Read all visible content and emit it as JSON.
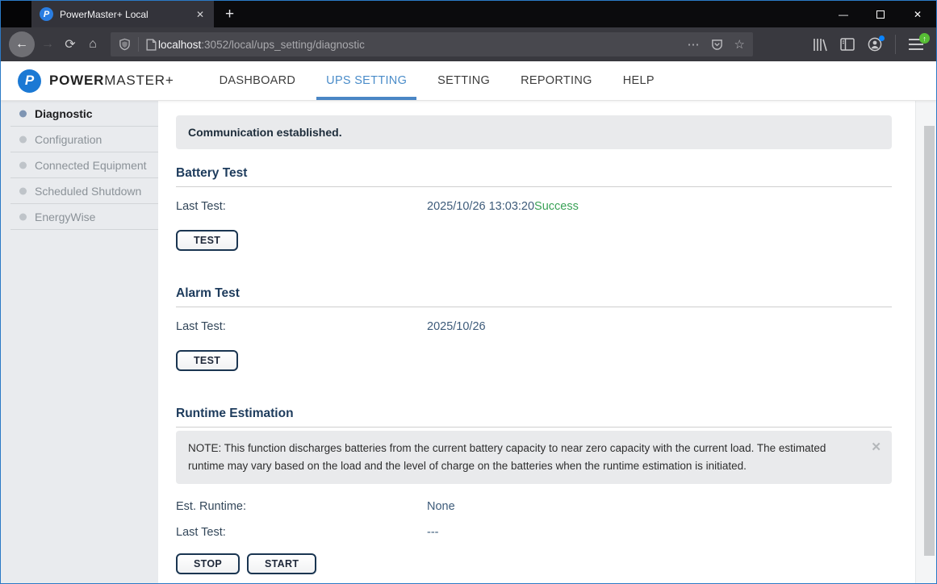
{
  "browser": {
    "tab_title": "PowerMaster+ Local",
    "favicon_letter": "P",
    "url_host": "localhost",
    "url_path": ":3052/local/ups_setting/diagnostic",
    "icons": {
      "tab_close": "✕",
      "new_tab": "+",
      "back": "←",
      "forward": "→",
      "reload": "⟳",
      "home": "⌂",
      "overflow": "⋯",
      "star": "☆",
      "minimize": "—",
      "window_close": "✕",
      "update_badge": "↑"
    }
  },
  "header": {
    "brand_bold": "POWER",
    "brand_rest": "MASTER+",
    "logo_letter": "P",
    "nav": [
      {
        "label": "DASHBOARD",
        "active": false
      },
      {
        "label": "UPS SETTING",
        "active": true
      },
      {
        "label": "SETTING",
        "active": false
      },
      {
        "label": "REPORTING",
        "active": false
      },
      {
        "label": "HELP",
        "active": false
      }
    ]
  },
  "sidebar": {
    "items": [
      {
        "label": "Diagnostic",
        "active": true
      },
      {
        "label": "Configuration",
        "active": false
      },
      {
        "label": "Connected Equipment",
        "active": false
      },
      {
        "label": "Scheduled Shutdown",
        "active": false
      },
      {
        "label": "EnergyWise",
        "active": false
      }
    ]
  },
  "page": {
    "banner": "Communication established.",
    "battery_test": {
      "title": "Battery Test",
      "last_label": "Last Test:",
      "last_time": "2025/10/26 13:03:20",
      "last_status": "Success",
      "button": "TEST"
    },
    "alarm_test": {
      "title": "Alarm Test",
      "last_label": "Last Test:",
      "last_time": "2025/10/26",
      "button": "TEST"
    },
    "runtime": {
      "title": "Runtime Estimation",
      "note": "NOTE: This function discharges batteries from the current battery capacity to near zero capacity with the current load. The estimated runtime may vary based on the load and the level of charge on the batteries when the runtime estimation is initiated.",
      "note_close": "✕",
      "est_label": "Est. Runtime:",
      "est_value": "None",
      "last_label": "Last Test:",
      "last_value": "---",
      "stop_button": "STOP",
      "start_button": "START"
    }
  },
  "colors": {
    "accent_blue": "#4a86c5",
    "active_nav_text": "#4a8cc9",
    "success_green": "#3aa257",
    "window_border": "#2b7ac6",
    "sidebar_bg": "#e9ebee",
    "banner_bg": "#e9eaec"
  }
}
